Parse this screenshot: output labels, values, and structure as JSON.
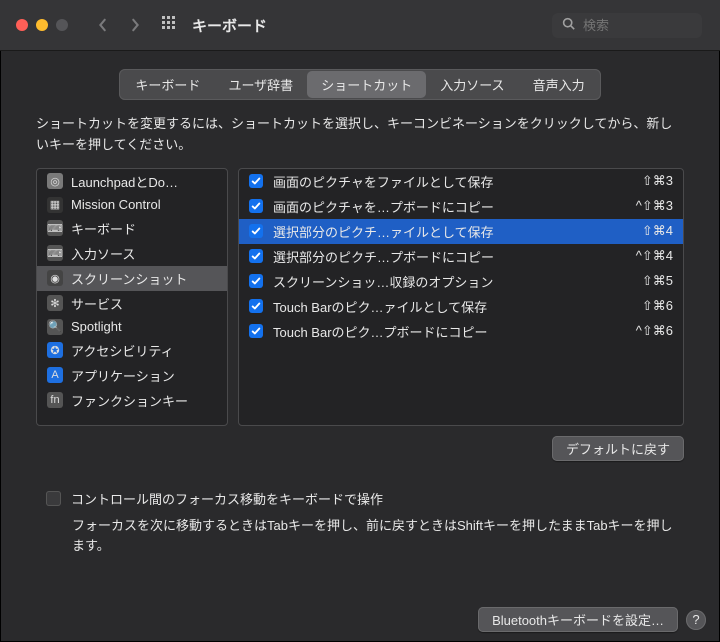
{
  "titlebar": {
    "title": "キーボード",
    "search_placeholder": "検索"
  },
  "tabs": [
    {
      "label": "キーボード",
      "selected": false
    },
    {
      "label": "ユーザ辞書",
      "selected": false
    },
    {
      "label": "ショートカット",
      "selected": true
    },
    {
      "label": "入力ソース",
      "selected": false
    },
    {
      "label": "音声入力",
      "selected": false
    }
  ],
  "instructions": "ショートカットを変更するには、ショートカットを選択し、キーコンビネーションをクリックしてから、新しいキーを押してください。",
  "sidebar": [
    {
      "id": "launchpad",
      "label": "LaunchpadとDo…",
      "icon_bg": "#7a7a7a",
      "icon_glyph": "◎"
    },
    {
      "id": "mission",
      "label": "Mission Control",
      "icon_bg": "#333",
      "icon_glyph": "▦"
    },
    {
      "id": "keyboard",
      "label": "キーボード",
      "icon_bg": "#555",
      "icon_glyph": "⌨"
    },
    {
      "id": "input-src",
      "label": "入力ソース",
      "icon_bg": "#555",
      "icon_glyph": "⌨"
    },
    {
      "id": "screenshot",
      "label": "スクリーンショット",
      "icon_bg": "#444",
      "icon_glyph": "◉",
      "selected": true
    },
    {
      "id": "services",
      "label": "サービス",
      "icon_bg": "#555",
      "icon_glyph": "✻"
    },
    {
      "id": "spotlight",
      "label": "Spotlight",
      "icon_bg": "#555",
      "icon_glyph": "🔍"
    },
    {
      "id": "a11y",
      "label": "アクセシビリティ",
      "icon_bg": "#1e6fe0",
      "icon_glyph": "✪"
    },
    {
      "id": "apps",
      "label": "アプリケーション",
      "icon_bg": "#1e6fe0",
      "icon_glyph": "A"
    },
    {
      "id": "fn",
      "label": "ファンクションキー",
      "icon_bg": "#555",
      "icon_glyph": "fn"
    }
  ],
  "shortcuts": [
    {
      "checked": true,
      "label": "画面のピクチャをファイルとして保存",
      "keys": "⇧⌘3"
    },
    {
      "checked": true,
      "label": "画面のピクチャを…プボードにコピー",
      "keys": "^⇧⌘3"
    },
    {
      "checked": true,
      "label": "選択部分のピクチ…ァイルとして保存",
      "keys": "⇧⌘4",
      "selected": true
    },
    {
      "checked": true,
      "label": "選択部分のピクチ…プボードにコピー",
      "keys": "^⇧⌘4"
    },
    {
      "checked": true,
      "label": "スクリーンショッ…収録のオプション",
      "keys": "⇧⌘5"
    },
    {
      "checked": true,
      "label": "Touch Barのピク…ァイルとして保存",
      "keys": "⇧⌘6"
    },
    {
      "checked": true,
      "label": "Touch Barのピク…プボードにコピー",
      "keys": "^⇧⌘6"
    }
  ],
  "restore_defaults": "デフォルトに戻す",
  "focus": {
    "checkbox_label": "コントロール間のフォーカス移動をキーボードで操作",
    "help": "フォーカスを次に移動するときはTabキーを押し、前に戻すときはShiftキーを押したままTabキーを押します。"
  },
  "footer": {
    "bt_button": "Bluetoothキーボードを設定…",
    "help_label": "?"
  }
}
